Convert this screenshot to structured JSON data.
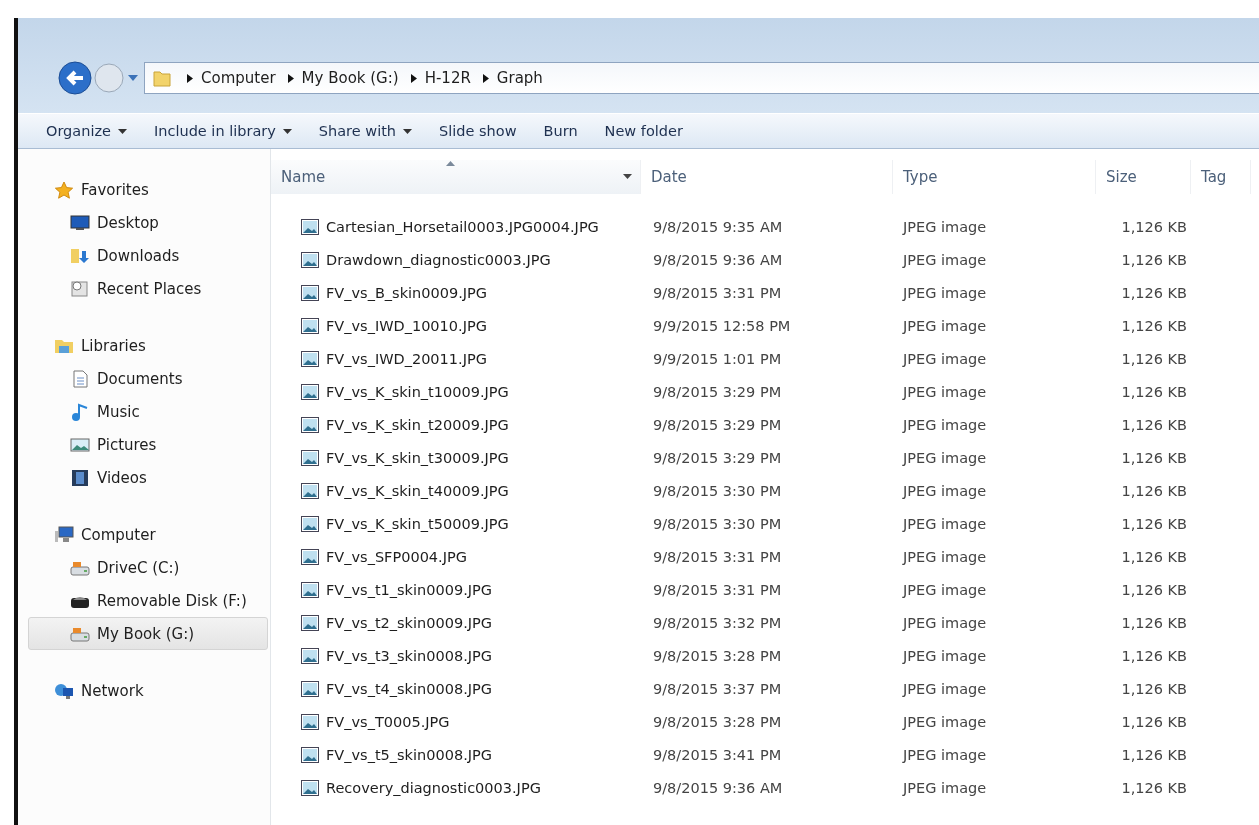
{
  "address_bar": {
    "path": [
      "Computer",
      "My Book (G:)",
      "H-12R",
      "Graph"
    ]
  },
  "toolbar": [
    {
      "label": "Organize",
      "dropdown": true
    },
    {
      "label": "Include in library",
      "dropdown": true
    },
    {
      "label": "Share with",
      "dropdown": true
    },
    {
      "label": "Slide show",
      "dropdown": false
    },
    {
      "label": "Burn",
      "dropdown": false
    },
    {
      "label": "New folder",
      "dropdown": false
    }
  ],
  "sidebar": {
    "sections": [
      {
        "label": "Favorites",
        "selected": false,
        "children": [
          {
            "label": "Desktop",
            "selected": false
          },
          {
            "label": "Downloads",
            "selected": false
          },
          {
            "label": "Recent Places",
            "selected": false
          }
        ]
      },
      {
        "label": "Libraries",
        "selected": false,
        "children": [
          {
            "label": "Documents",
            "selected": false
          },
          {
            "label": "Music",
            "selected": false
          },
          {
            "label": "Pictures",
            "selected": false
          },
          {
            "label": "Videos",
            "selected": false
          }
        ]
      },
      {
        "label": "Computer",
        "selected": false,
        "children": [
          {
            "label": "DriveC (C:)",
            "selected": false
          },
          {
            "label": "Removable Disk (F:)",
            "selected": false
          },
          {
            "label": "My Book (G:)",
            "selected": true
          }
        ]
      },
      {
        "label": "Network",
        "selected": false
      }
    ]
  },
  "table": {
    "columns": [
      {
        "label": "Name",
        "sorted": true
      },
      {
        "label": "Date",
        "sorted": false
      },
      {
        "label": "Type",
        "sorted": false
      },
      {
        "label": "Size",
        "sorted": false
      },
      {
        "label": "Tag",
        "sorted": false
      }
    ],
    "rows": [
      {
        "name": "Cartesian_Horsetail0003.JPG0004.JPG",
        "date": "9/8/2015 9:35 AM",
        "type": "JPEG image",
        "size": "1,126 KB"
      },
      {
        "name": "Drawdown_diagnostic0003.JPG",
        "date": "9/8/2015 9:36 AM",
        "type": "JPEG image",
        "size": "1,126 KB"
      },
      {
        "name": "FV_vs_B_skin0009.JPG",
        "date": "9/8/2015 3:31 PM",
        "type": "JPEG image",
        "size": "1,126 KB"
      },
      {
        "name": "FV_vs_IWD_10010.JPG",
        "date": "9/9/2015 12:58 PM",
        "type": "JPEG image",
        "size": "1,126 KB"
      },
      {
        "name": "FV_vs_IWD_20011.JPG",
        "date": "9/9/2015 1:01 PM",
        "type": "JPEG image",
        "size": "1,126 KB"
      },
      {
        "name": "FV_vs_K_skin_t10009.JPG",
        "date": "9/8/2015 3:29 PM",
        "type": "JPEG image",
        "size": "1,126 KB"
      },
      {
        "name": "FV_vs_K_skin_t20009.JPG",
        "date": "9/8/2015 3:29 PM",
        "type": "JPEG image",
        "size": "1,126 KB"
      },
      {
        "name": "FV_vs_K_skin_t30009.JPG",
        "date": "9/8/2015 3:29 PM",
        "type": "JPEG image",
        "size": "1,126 KB"
      },
      {
        "name": "FV_vs_K_skin_t40009.JPG",
        "date": "9/8/2015 3:30 PM",
        "type": "JPEG image",
        "size": "1,126 KB"
      },
      {
        "name": "FV_vs_K_skin_t50009.JPG",
        "date": "9/8/2015 3:30 PM",
        "type": "JPEG image",
        "size": "1,126 KB"
      },
      {
        "name": "FV_vs_SFP0004.JPG",
        "date": "9/8/2015 3:31 PM",
        "type": "JPEG image",
        "size": "1,126 KB"
      },
      {
        "name": "FV_vs_t1_skin0009.JPG",
        "date": "9/8/2015 3:31 PM",
        "type": "JPEG image",
        "size": "1,126 KB"
      },
      {
        "name": "FV_vs_t2_skin0009.JPG",
        "date": "9/8/2015 3:32 PM",
        "type": "JPEG image",
        "size": "1,126 KB"
      },
      {
        "name": "FV_vs_t3_skin0008.JPG",
        "date": "9/8/2015 3:28 PM",
        "type": "JPEG image",
        "size": "1,126 KB"
      },
      {
        "name": "FV_vs_t4_skin0008.JPG",
        "date": "9/8/2015 3:37 PM",
        "type": "JPEG image",
        "size": "1,126 KB"
      },
      {
        "name": "FV_vs_T0005.JPG",
        "date": "9/8/2015 3:28 PM",
        "type": "JPEG image",
        "size": "1,126 KB"
      },
      {
        "name": "FV_vs_t5_skin0008.JPG",
        "date": "9/8/2015 3:41 PM",
        "type": "JPEG image",
        "size": "1,126 KB"
      },
      {
        "name": "Recovery_diagnostic0003.JPG",
        "date": "9/8/2015 9:36 AM",
        "type": "JPEG image",
        "size": "1,126 KB"
      }
    ]
  }
}
